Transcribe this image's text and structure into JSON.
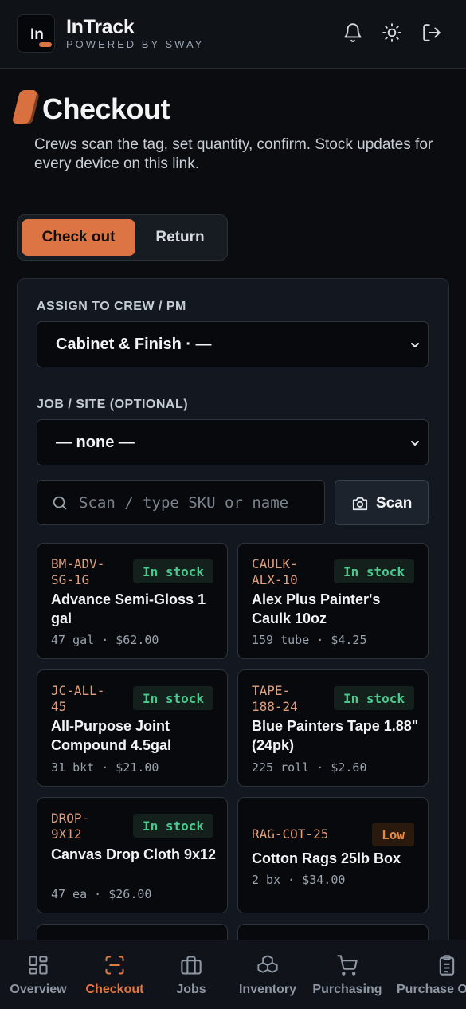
{
  "header": {
    "logo_text": "In",
    "title": "InTrack",
    "subtitle": "POWERED BY SWAY",
    "icons": [
      "bell-icon",
      "sun-icon",
      "logout-icon"
    ]
  },
  "page": {
    "title": "Checkout",
    "description": "Crews scan the tag, set quantity, confirm. Stock updates for every device on this link."
  },
  "mode_toggle": {
    "active": "Check out",
    "inactive": "Return"
  },
  "form": {
    "crew_label": "ASSIGN TO CREW / PM",
    "crew_value": "Cabinet & Finish · —",
    "job_label": "JOB / SITE (OPTIONAL)",
    "job_value": "— none —",
    "search_placeholder": "Scan / type SKU or name",
    "scan_label": "Scan"
  },
  "products": [
    {
      "sku_line1": "BM-ADV-",
      "sku_line2": "SG-1G",
      "status": "In stock",
      "name": "Advance Semi-Gloss 1 gal",
      "meta": "47 gal · $62.00"
    },
    {
      "sku_line1": "CAULK-",
      "sku_line2": "ALX-10",
      "status": "In stock",
      "name": "Alex Plus Painter's Caulk 10oz",
      "meta": "159 tube · $4.25"
    },
    {
      "sku_line1": "JC-ALL-",
      "sku_line2": "45",
      "status": "In stock",
      "name": "All-Purpose Joint Compound 4.5gal",
      "meta": "31 bkt · $21.00"
    },
    {
      "sku_line1": "TAPE-",
      "sku_line2": "188-24",
      "status": "In stock",
      "name": "Blue Painters Tape 1.88\" (24pk)",
      "meta": "225 roll · $2.60"
    },
    {
      "sku_line1": "DROP-",
      "sku_line2": "9X12",
      "status": "In stock",
      "name": "Canvas Drop Cloth 9x12",
      "meta": "47 ea · $26.00"
    },
    {
      "sku_line1": "RAG-COT-25",
      "sku_line2": "",
      "status": "Low",
      "name": "Cotton Rags 25lb Box",
      "meta": "2 bx · $34.00"
    }
  ],
  "colors": {
    "accent": "#dd7444",
    "in_stock": "#49c98d",
    "low": "#e58943"
  },
  "bottom_nav": {
    "active": "Checkout",
    "items": [
      {
        "label": "Overview",
        "icon": "grid-icon"
      },
      {
        "label": "Checkout",
        "icon": "scan-icon"
      },
      {
        "label": "Jobs",
        "icon": "briefcase-icon"
      },
      {
        "label": "Inventory",
        "icon": "boxes-icon"
      },
      {
        "label": "Purchasing",
        "icon": "cart-icon"
      },
      {
        "label": "Purchase O",
        "icon": "clipboard-icon"
      }
    ]
  }
}
